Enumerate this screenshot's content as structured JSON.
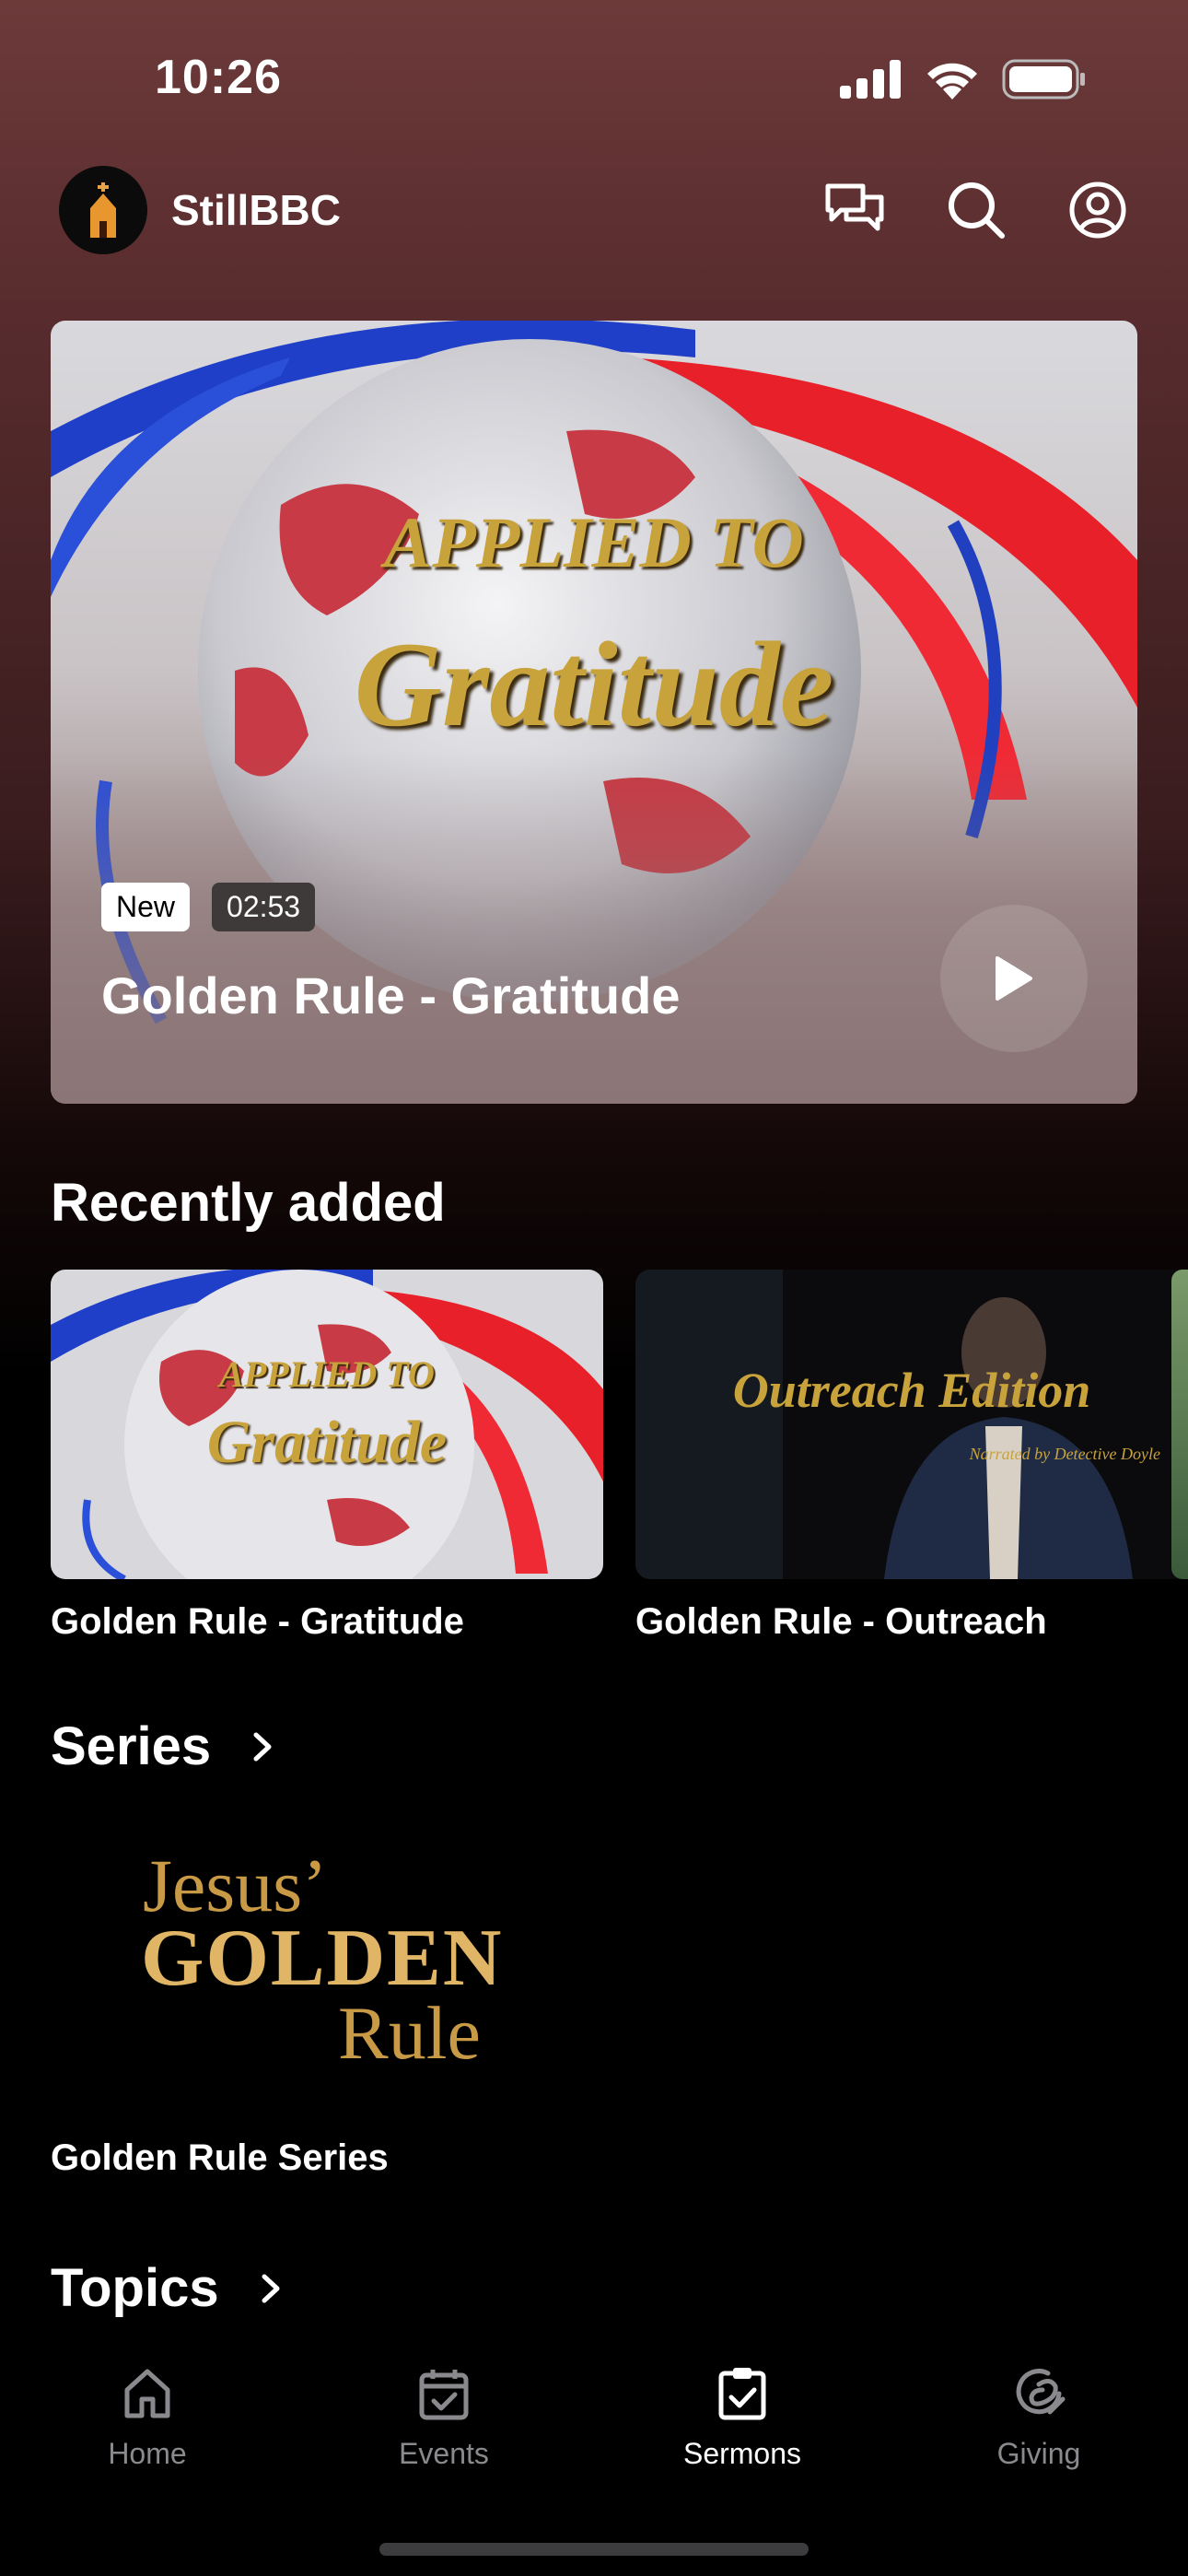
{
  "status_bar": {
    "time": "10:26"
  },
  "header": {
    "app_name": "StillBBC"
  },
  "hero": {
    "art_line1": "APPLIED TO",
    "art_line2": "Gratitude",
    "badge_new": "New",
    "duration": "02:53",
    "title": "Golden Rule - Gratitude"
  },
  "recently_added": {
    "title": "Recently added",
    "items": [
      {
        "title": "Golden Rule - Gratitude",
        "art_line1": "APPLIED TO",
        "art_line2": "Gratitude"
      },
      {
        "title": "Golden Rule - Outreach",
        "art_line1": "Outreach Edition",
        "art_line2": "Narrated by Detective Doyle"
      }
    ]
  },
  "series": {
    "title": "Series",
    "items": [
      {
        "title": "Golden Rule Series",
        "art_line1": "Jesus’",
        "art_line2": "GOLDEN",
        "art_line3": "Rule"
      }
    ]
  },
  "topics": {
    "title": "Topics"
  },
  "tabbar": {
    "items": [
      {
        "label": "Home",
        "icon": "home-icon"
      },
      {
        "label": "Events",
        "icon": "calendar-check-icon"
      },
      {
        "label": "Sermons",
        "icon": "clipboard-check-icon",
        "active": true
      },
      {
        "label": "Giving",
        "icon": "giving-icon"
      }
    ]
  }
}
